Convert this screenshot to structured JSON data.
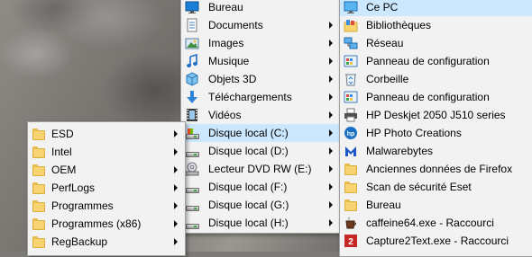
{
  "explorer_menu": {
    "items": [
      {
        "label": "Bureau",
        "icon": "desktop-icon",
        "submenu": false
      },
      {
        "label": "Documents",
        "icon": "documents-icon",
        "submenu": true
      },
      {
        "label": "Images",
        "icon": "images-icon",
        "submenu": true
      },
      {
        "label": "Musique",
        "icon": "music-icon",
        "submenu": true
      },
      {
        "label": "Objets 3D",
        "icon": "objects-3d-icon",
        "submenu": true
      },
      {
        "label": "Téléchargements",
        "icon": "downloads-icon",
        "submenu": true
      },
      {
        "label": "Vidéos",
        "icon": "videos-icon",
        "submenu": true
      },
      {
        "label": "Disque local (C:)",
        "icon": "system-drive-icon",
        "submenu": true,
        "highlighted": true
      },
      {
        "label": "Disque local (D:)",
        "icon": "drive-icon",
        "submenu": true
      },
      {
        "label": "Lecteur DVD RW (E:)",
        "icon": "dvd-drive-icon",
        "submenu": true
      },
      {
        "label": "Disque local (F:)",
        "icon": "drive-icon",
        "submenu": true
      },
      {
        "label": "Disque local (G:)",
        "icon": "drive-icon",
        "submenu": true
      },
      {
        "label": "Disque local (H:)",
        "icon": "drive-icon",
        "submenu": true
      }
    ]
  },
  "drive_c_menu": {
    "items": [
      {
        "label": "ESD",
        "icon": "folder-icon"
      },
      {
        "label": "Intel",
        "icon": "folder-icon"
      },
      {
        "label": "OEM",
        "icon": "folder-icon"
      },
      {
        "label": "PerfLogs",
        "icon": "folder-icon"
      },
      {
        "label": "Programmes",
        "icon": "folder-icon"
      },
      {
        "label": "Programmes (x86)",
        "icon": "folder-icon"
      },
      {
        "label": "RegBackup",
        "icon": "folder-icon"
      }
    ]
  },
  "desktop_menu": {
    "items": [
      {
        "label": "Ce PC",
        "icon": "this-pc-icon",
        "highlighted": true
      },
      {
        "label": "Bibliothèques",
        "icon": "libraries-icon"
      },
      {
        "label": "Réseau",
        "icon": "network-icon"
      },
      {
        "label": "Panneau de configuration",
        "icon": "control-panel-icon"
      },
      {
        "label": "Corbeille",
        "icon": "recycle-bin-icon"
      },
      {
        "label": "Panneau de configuration",
        "icon": "control-panel-icon"
      },
      {
        "label": "HP Deskjet 2050 J510 series",
        "icon": "printer-icon"
      },
      {
        "label": "HP Photo Creations",
        "icon": "hp-photo-icon"
      },
      {
        "label": "Malwarebytes",
        "icon": "malwarebytes-icon"
      },
      {
        "label": "Anciennes données de Firefox",
        "icon": "folder-icon"
      },
      {
        "label": "Scan de sécurité Eset",
        "icon": "folder-icon"
      },
      {
        "label": "Bureau",
        "icon": "folder-icon"
      },
      {
        "label": "caffeine64.exe - Raccourci",
        "icon": "caffeine-icon"
      },
      {
        "label": "Capture2Text.exe - Raccourci",
        "icon": "capture2text-icon"
      }
    ]
  },
  "colors": {
    "menu_background": "#f2f2f2",
    "highlight": "#cce8ff",
    "border": "#a0a0a0"
  }
}
